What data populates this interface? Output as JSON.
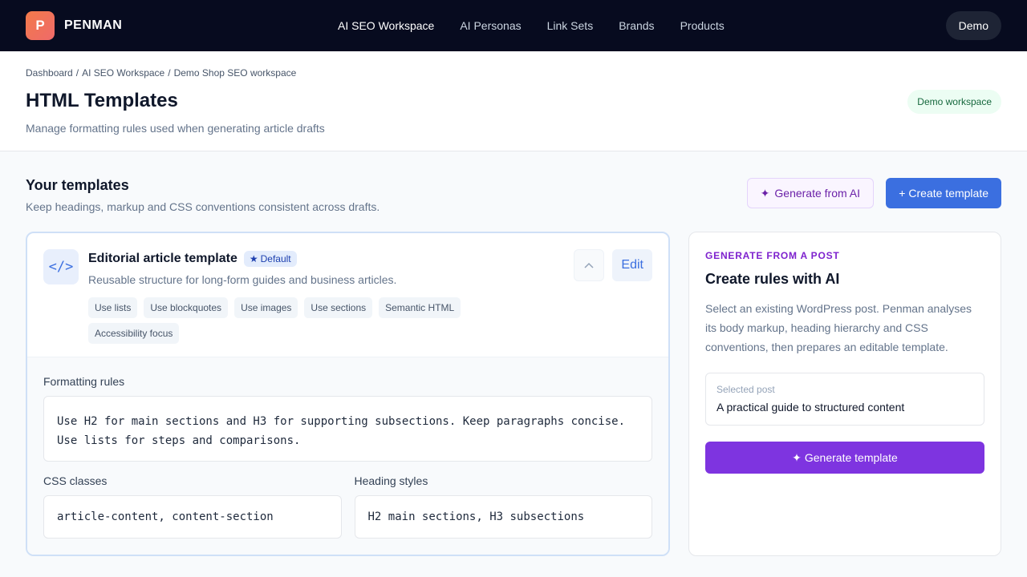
{
  "app": {
    "logo_letter": "P",
    "brand": "PENMAN",
    "nav": [
      {
        "label": "AI SEO Workspace"
      },
      {
        "label": "AI Personas"
      },
      {
        "label": "Link Sets"
      },
      {
        "label": "Brands"
      },
      {
        "label": "Products"
      }
    ],
    "demo_label": "Demo"
  },
  "header": {
    "breadcrumb": [
      "Dashboard",
      "/",
      "AI SEO Workspace",
      "/",
      "Demo Shop SEO workspace"
    ],
    "title": "HTML Templates",
    "subtitle": "Manage formatting rules used when generating article drafts",
    "workspace_badge": "Demo workspace"
  },
  "section": {
    "title": "Your templates",
    "subtitle": "Keep headings, markup and CSS conventions consistent across drafts.",
    "generate_ai_label": "Generate from AI",
    "generate_ai_icon": "✦",
    "create_label": "Create template",
    "create_icon": "+"
  },
  "template": {
    "icon_glyph": "</>",
    "title": "Editorial article template",
    "default_badge": "Default",
    "default_icon": "★",
    "description": "Reusable structure for long-form guides and business articles.",
    "tags": [
      "Use lists",
      "Use blockquotes",
      "Use images",
      "Use sections",
      "Semantic HTML",
      "Accessibility focus"
    ],
    "edit_label": "Edit",
    "rules_label": "Formatting rules",
    "rules_line1": "Use H2 for main sections and H3 for supporting subsections. Keep paragraphs concise.",
    "rules_line2": "Use lists for steps and comparisons.",
    "css_label": "CSS classes",
    "css_value": "article-content, content-section",
    "heading_label": "Heading styles",
    "heading_value": "H2 main sections, H3 subsections"
  },
  "side": {
    "kicker": "GENERATE FROM A POST",
    "title": "Create rules with AI",
    "description": "Select an existing WordPress post. Penman analyses its body markup, heading hierarchy and CSS conventions, then prepares an editable template.",
    "selected_label": "Selected post",
    "selected_value": "A practical guide to structured content",
    "generate_label": "Generate template",
    "generate_icon": "✦"
  }
}
